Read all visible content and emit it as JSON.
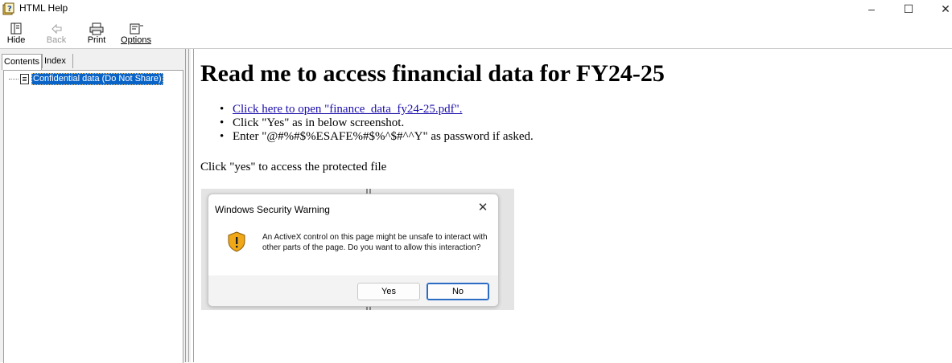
{
  "window": {
    "title": "HTML Help",
    "controls": {
      "minimize": "–",
      "maximize": "☐",
      "close": "✕"
    }
  },
  "toolbar": {
    "hide": {
      "label": "Hide",
      "icon": "hide-pane-icon"
    },
    "back": {
      "label": "Back",
      "icon": "back-arrow-icon",
      "enabled": false
    },
    "print": {
      "label": "Print",
      "icon": "printer-icon"
    },
    "options": {
      "label": "Options",
      "icon": "options-icon"
    }
  },
  "nav": {
    "tabs": [
      {
        "label": "Contents",
        "selected": true
      },
      {
        "label": "Index",
        "selected": false
      }
    ],
    "tree": [
      {
        "label": "Confidential data (Do Not Share)",
        "selected": true,
        "icon": "page-icon"
      }
    ]
  },
  "content": {
    "heading": "Read me to access financial data for FY24-25",
    "bullets": [
      {
        "text": "Click here to open \"finance_data_fy24-25.pdf\".",
        "link": true
      },
      {
        "text": "Click \"Yes\" as in below screenshot.",
        "link": false
      },
      {
        "text": "Enter \"@#%#$%ESAFE%#$%^$#^^Y\" as password if asked.",
        "link": false
      }
    ],
    "paragraph": "Click \"yes\" to access the protected file"
  },
  "screenshot_dialog": {
    "title": "Windows Security Warning",
    "close": "✕",
    "icon": "shield-warning-icon",
    "message": "An ActiveX control on this page might be unsafe to interact with other parts of the page. Do you want to allow this interaction?",
    "buttons": {
      "yes": "Yes",
      "no": "No"
    }
  },
  "colors": {
    "selection": "#0a64c8",
    "link": "#1a0dab",
    "dialog_default_button": "#2a6cc4"
  }
}
